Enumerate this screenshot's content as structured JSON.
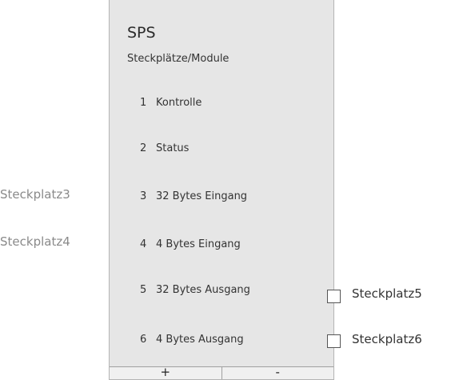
{
  "panel": {
    "title": "SPS",
    "subtitle": "Steckplätze/Module"
  },
  "slots": [
    {
      "number": "1",
      "label": "Kontrolle"
    },
    {
      "number": "2",
      "label": "Status"
    },
    {
      "number": "3",
      "label": "32 Bytes Eingang"
    },
    {
      "number": "4",
      "label": "4 Bytes Eingang"
    },
    {
      "number": "5",
      "label": "32 Bytes Ausgang"
    },
    {
      "number": "6",
      "label": "4 Bytes Ausgang"
    }
  ],
  "left_labels": {
    "slot3": "Steckplatz3",
    "slot4": "Steckplatz4"
  },
  "right_labels": {
    "slot5": "Steckplatz5",
    "slot6": "Steckplatz6"
  },
  "buttons": {
    "add_label": "+",
    "remove_label": "-"
  }
}
